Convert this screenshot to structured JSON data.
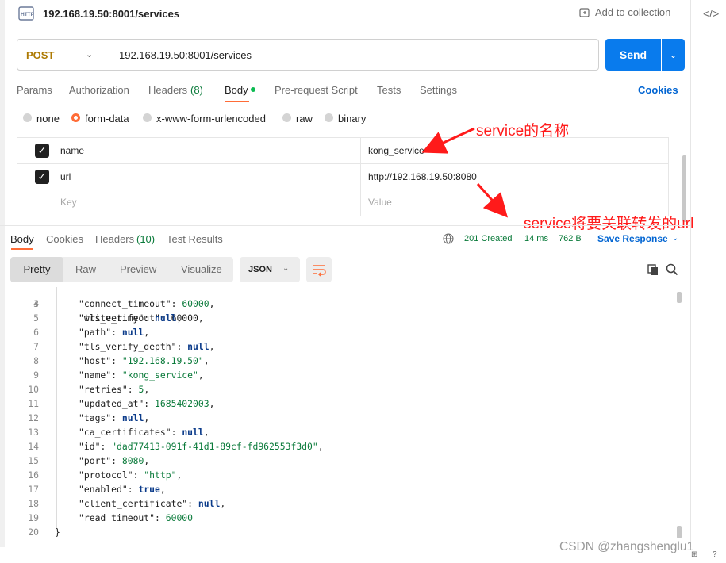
{
  "header": {
    "title": "192.168.19.50:8001/services",
    "add_collection": "Add to collection"
  },
  "request": {
    "method": "POST",
    "url": "192.168.19.50:8001/services",
    "send_label": "Send"
  },
  "request_tabs": [
    "Params",
    "Authorization",
    "Headers",
    "(8)",
    "Body",
    "Pre-request Script",
    "Tests",
    "Settings"
  ],
  "cookies": "Cookies",
  "body_types": [
    "none",
    "form-data",
    "x-www-form-urlencoded",
    "raw",
    "binary"
  ],
  "body_type_selected": "form-data",
  "form_rows": [
    {
      "key": "name",
      "value": "kong_service",
      "checked": true
    },
    {
      "key": "url",
      "value": "http://192.168.19.50:8080",
      "checked": true
    }
  ],
  "form_placeholder": {
    "key": "Key",
    "value": "Value"
  },
  "annotations": {
    "a1": "service的名称",
    "a2": "service将要关联转发的url"
  },
  "response_tabs": [
    "Body",
    "Cookies",
    "Headers",
    "(10)",
    "Test Results"
  ],
  "response_meta": {
    "status": "201 Created",
    "time": "14 ms",
    "size": "762 B",
    "save_label": "Save Response"
  },
  "view_modes": [
    "Pretty",
    "Raw",
    "Preview",
    "Visualize"
  ],
  "format": "JSON",
  "code_partial_top": "\"write_timeout\": 60000,",
  "code_lines": [
    {
      "n": "3",
      "key": "",
      "val": "",
      "t": "x"
    },
    {
      "n": "4",
      "key": "\"connect_timeout\"",
      "val": "60000",
      "t": "n"
    },
    {
      "n": "5",
      "key": "\"tls_verify\"",
      "val": "null",
      "t": "kw"
    },
    {
      "n": "6",
      "key": "\"path\"",
      "val": "null",
      "t": "kw"
    },
    {
      "n": "7",
      "key": "\"tls_verify_depth\"",
      "val": "null",
      "t": "kw"
    },
    {
      "n": "8",
      "key": "\"host\"",
      "val": "\"192.168.19.50\"",
      "t": "s"
    },
    {
      "n": "9",
      "key": "\"name\"",
      "val": "\"kong_service\"",
      "t": "s"
    },
    {
      "n": "10",
      "key": "\"retries\"",
      "val": "5",
      "t": "n"
    },
    {
      "n": "11",
      "key": "\"updated_at\"",
      "val": "1685402003",
      "t": "n"
    },
    {
      "n": "12",
      "key": "\"tags\"",
      "val": "null",
      "t": "kw"
    },
    {
      "n": "13",
      "key": "\"ca_certificates\"",
      "val": "null",
      "t": "kw"
    },
    {
      "n": "14",
      "key": "\"id\"",
      "val": "\"dad77413-091f-41d1-89cf-fd962553f3d0\"",
      "t": "s"
    },
    {
      "n": "15",
      "key": "\"port\"",
      "val": "8080",
      "t": "n"
    },
    {
      "n": "16",
      "key": "\"protocol\"",
      "val": "\"http\"",
      "t": "s"
    },
    {
      "n": "17",
      "key": "\"enabled\"",
      "val": "true",
      "t": "kw"
    },
    {
      "n": "18",
      "key": "\"client_certificate\"",
      "val": "null",
      "t": "kw"
    },
    {
      "n": "19",
      "key": "\"read_timeout\"",
      "val": "60000",
      "t": "n"
    },
    {
      "n": "20",
      "key": "",
      "val": "",
      "t": "end"
    }
  ],
  "watermark": "CSDN @zhangshenglu1"
}
